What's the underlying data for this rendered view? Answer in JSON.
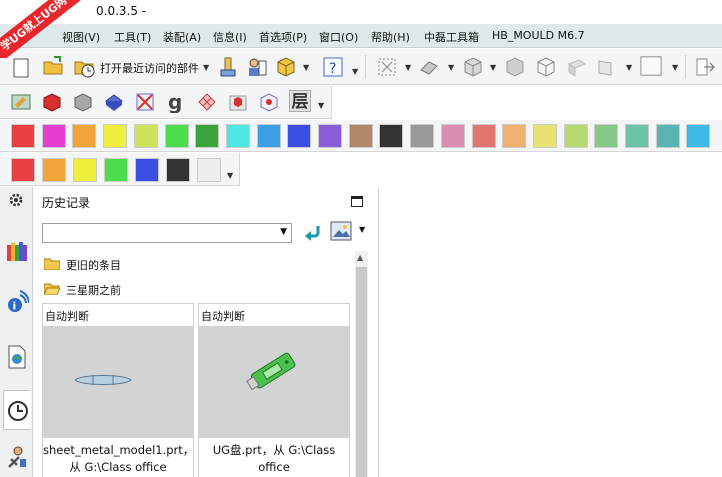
{
  "window": {
    "title": "0.0.3.5 -"
  },
  "logo": {
    "tag": "9SUG",
    "text": "学UG就上UG网"
  },
  "menu": [
    {
      "id": "view",
      "label": "视图(V)"
    },
    {
      "id": "tools",
      "label": "工具(T)"
    },
    {
      "id": "assembly",
      "label": "装配(A)"
    },
    {
      "id": "info",
      "label": "信息(I)"
    },
    {
      "id": "prefs",
      "label": "首选项(P)"
    },
    {
      "id": "window",
      "label": "窗口(O)"
    },
    {
      "id": "help",
      "label": "帮助(H)"
    },
    {
      "id": "zhongxin",
      "label": "中磊工具箱"
    },
    {
      "id": "hbmould",
      "label": "HB_MOULD M6.7"
    }
  ],
  "toolbar": {
    "recent_parts_label": "打开最近访问的部件"
  },
  "toolbar2": {
    "layer_label": "层"
  },
  "colors": {
    "row1": [
      "#e84040",
      "#e83fd2",
      "#f0a43a",
      "#eeee3c",
      "#cfe35a",
      "#4ddc4d",
      "#3ba33b",
      "#4fe6e2",
      "#3aa0e6",
      "#3a4ee6",
      "#8a5cd8",
      "#b08866",
      "#333333",
      "#9a9a9a",
      "#d88fb2",
      "#e0756e",
      "#f0b070",
      "#e8e070",
      "#b8d870",
      "#88c888",
      "#6cc4a8",
      "#5ab4b4",
      "#40b8e8"
    ],
    "row2": [
      "#e84040",
      "#f0a43a",
      "#eeee3c",
      "#4ddc4d",
      "#3a4ee6",
      "#333333",
      "#eeeeee"
    ]
  },
  "history": {
    "title": "历史记录",
    "combo_value": "",
    "folders": [
      {
        "id": "older",
        "label": "更旧的条目"
      },
      {
        "id": "three-weeks",
        "label": "三星期之前"
      }
    ],
    "cards": [
      {
        "id": "sheet",
        "tag": "自动判断",
        "name_line1": "sheet_metal_model1.prt，",
        "name_line2": "从 G:\\Class office"
      },
      {
        "id": "ugdisk",
        "tag": "自动判断",
        "name_line1": "UG盘.prt，从 G:\\Class",
        "name_line2": "office"
      }
    ]
  }
}
